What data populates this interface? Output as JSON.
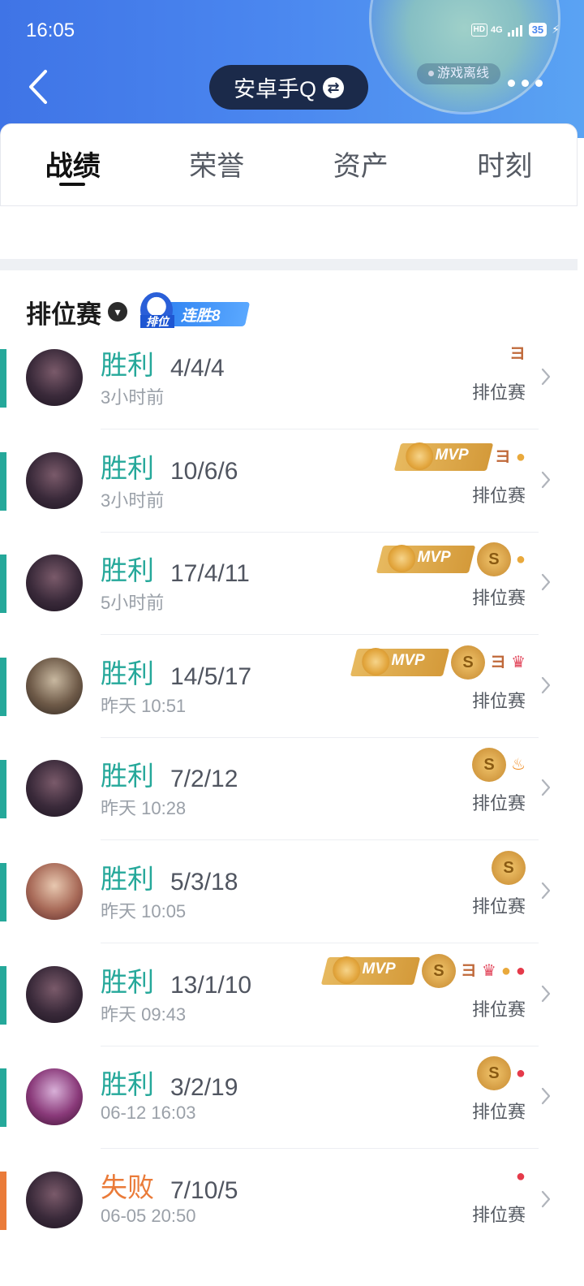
{
  "status_bar": {
    "time": "16:05",
    "hd": "HD",
    "network": "4G",
    "battery": "35"
  },
  "header": {
    "title": "安卓手Q",
    "swap_glyph": "⇄",
    "status_text": "游戏离线"
  },
  "tabs": [
    {
      "label": "战绩",
      "active": true
    },
    {
      "label": "荣誉",
      "active": false
    },
    {
      "label": "资产",
      "active": false
    },
    {
      "label": "时刻",
      "active": false
    }
  ],
  "section": {
    "title": "排位赛",
    "streak_badge": {
      "mode": "排位",
      "text": "连胜8"
    }
  },
  "matches": [
    {
      "result": "胜利",
      "kda": "4/4/4",
      "time": "3小时前",
      "mode": "排位赛",
      "badges": [
        "three-icon"
      ]
    },
    {
      "result": "胜利",
      "kda": "10/6/6",
      "time": "3小时前",
      "mode": "排位赛",
      "badges": [
        "mvp-badge",
        "three-icon",
        "coins-icon"
      ]
    },
    {
      "result": "胜利",
      "kda": "17/4/11",
      "time": "5小时前",
      "mode": "排位赛",
      "badges": [
        "mvp-badge",
        "s-medal",
        "coins-icon"
      ]
    },
    {
      "result": "胜利",
      "kda": "14/5/17",
      "time": "昨天 10:51",
      "mode": "排位赛",
      "badges": [
        "mvp-badge",
        "s-medal",
        "three-icon",
        "crown-icon"
      ]
    },
    {
      "result": "胜利",
      "kda": "7/2/12",
      "time": "昨天 10:28",
      "mode": "排位赛",
      "badges": [
        "s-medal",
        "fire-icon"
      ]
    },
    {
      "result": "胜利",
      "kda": "5/3/18",
      "time": "昨天 10:05",
      "mode": "排位赛",
      "badges": [
        "s-medal"
      ]
    },
    {
      "result": "胜利",
      "kda": "13/1/10",
      "time": "昨天 09:43",
      "mode": "排位赛",
      "badges": [
        "mvp-badge",
        "s-medal",
        "three-icon",
        "crown-icon",
        "coins-icon",
        "blood-icon"
      ]
    },
    {
      "result": "胜利",
      "kda": "3/2/19",
      "time": "06-12 16:03",
      "mode": "排位赛",
      "badges": [
        "s-medal",
        "blood-icon"
      ]
    },
    {
      "result": "失败",
      "kda": "7/10/5",
      "time": "06-05 20:50",
      "mode": "排位赛",
      "badges": [
        "blood-icon"
      ]
    }
  ],
  "labels": {
    "mvp": "MVP",
    "s": "S"
  },
  "colors": {
    "win": "#25a89a",
    "loss": "#ea7b39",
    "header_start": "#3f74e6",
    "header_end": "#5aa3f3"
  }
}
